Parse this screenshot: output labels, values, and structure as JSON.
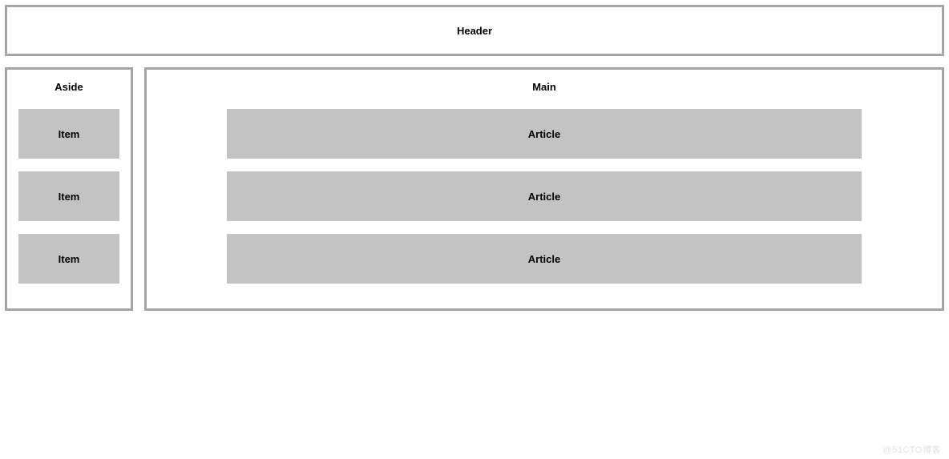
{
  "header": {
    "label": "Header"
  },
  "aside": {
    "label": "Aside",
    "items": [
      {
        "label": "Item"
      },
      {
        "label": "Item"
      },
      {
        "label": "Item"
      }
    ]
  },
  "main": {
    "label": "Main",
    "articles": [
      {
        "label": "Article"
      },
      {
        "label": "Article"
      },
      {
        "label": "Article"
      }
    ]
  },
  "watermark": "@51CTO博客"
}
